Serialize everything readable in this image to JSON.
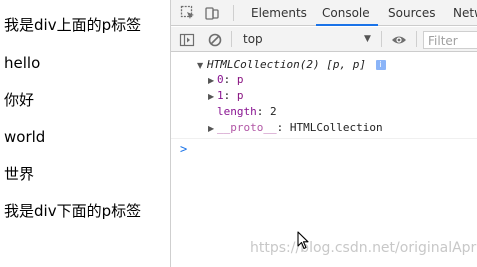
{
  "page": {
    "paragraphs": [
      "我是div上面的p标签",
      "hello",
      "你好",
      "world",
      "世界",
      "我是div下面的p标签"
    ]
  },
  "devtools": {
    "tabs": [
      "Elements",
      "Console",
      "Sources",
      "Netw"
    ],
    "active_tab": "Console",
    "context_select": "top",
    "filter_placeholder": "Filter",
    "colors": {
      "accent": "#1a73e8",
      "key": "#881391"
    },
    "console": {
      "collection_label": "HTMLCollection(2)",
      "collection_items": "[p, p]",
      "info_badge": "i",
      "entries": [
        {
          "key": "0",
          "sep": ": ",
          "value": "p"
        },
        {
          "key": "1",
          "sep": ": ",
          "value": "p"
        },
        {
          "key": "length",
          "sep": ": ",
          "value": "2"
        },
        {
          "key": "__proto__",
          "sep": ": ",
          "value": "HTMLCollection"
        }
      ],
      "prompt_symbol": ">"
    }
  },
  "watermark": "https://blog.csdn.net/originalApril"
}
